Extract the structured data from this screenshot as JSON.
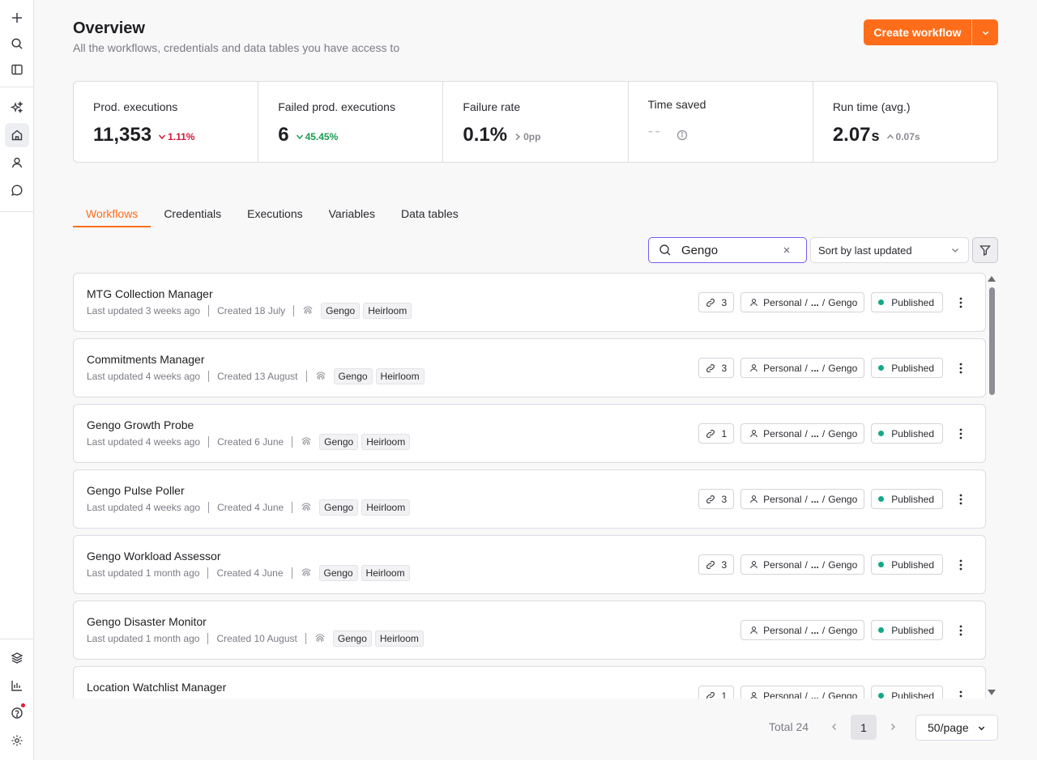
{
  "sidebar": {
    "top": [
      {
        "name": "plus-icon"
      },
      {
        "name": "search-icon"
      },
      {
        "name": "panel-toggle-icon"
      }
    ],
    "nav": [
      {
        "name": "sparkles-icon"
      },
      {
        "name": "home-icon",
        "active": true
      },
      {
        "name": "user-icon"
      },
      {
        "name": "chat-icon"
      }
    ],
    "bottom": [
      {
        "name": "templates-icon"
      },
      {
        "name": "insights-chart-icon"
      },
      {
        "name": "help-icon",
        "notification": true
      },
      {
        "name": "settings-gear-icon"
      }
    ]
  },
  "header": {
    "title": "Overview",
    "subtitle": "All the workflows, credentials and data tables you have access to",
    "create_button": "Create workflow"
  },
  "stats": [
    {
      "label": "Prod. executions",
      "value": "11,353",
      "unit": "",
      "delta": "1.11%",
      "delta_dir": "down",
      "delta_color": "red"
    },
    {
      "label": "Failed prod. executions",
      "value": "6",
      "unit": "",
      "delta": "45.45%",
      "delta_dir": "down",
      "delta_color": "green"
    },
    {
      "label": "Failure rate",
      "value": "0.1%",
      "unit": "",
      "delta": "0pp",
      "delta_dir": "right",
      "delta_color": "gray"
    },
    {
      "label": "Time saved",
      "value": "--",
      "unit": "",
      "delta": "",
      "delta_dir": "none",
      "delta_color": "gray"
    },
    {
      "label": "Run time (avg.)",
      "value": "2.07",
      "unit": "s",
      "delta": "0.07s",
      "delta_dir": "up",
      "delta_color": "gray"
    }
  ],
  "tabs": [
    "Workflows",
    "Credentials",
    "Executions",
    "Variables",
    "Data tables"
  ],
  "active_tab": "Workflows",
  "search": {
    "value": "Gengo",
    "placeholder": "Search"
  },
  "sort": {
    "selected": "Sort by last updated"
  },
  "workflows": [
    {
      "title": "MTG Collection Manager",
      "updated": "Last updated 3 weeks ago",
      "created": "Created 18 July",
      "tags": [
        "Gengo",
        "Heirloom"
      ],
      "links": "3",
      "project": "Personal",
      "ellipsis": "...",
      "folder": "Gengo",
      "status": "Published"
    },
    {
      "title": "Commitments Manager",
      "updated": "Last updated 4 weeks ago",
      "created": "Created 13 August",
      "tags": [
        "Gengo",
        "Heirloom"
      ],
      "links": "3",
      "project": "Personal",
      "ellipsis": "...",
      "folder": "Gengo",
      "status": "Published"
    },
    {
      "title": "Gengo Growth Probe",
      "updated": "Last updated 4 weeks ago",
      "created": "Created 6 June",
      "tags": [
        "Gengo",
        "Heirloom"
      ],
      "links": "1",
      "project": "Personal",
      "ellipsis": "...",
      "folder": "Gengo",
      "status": "Published"
    },
    {
      "title": "Gengo Pulse Poller",
      "updated": "Last updated 4 weeks ago",
      "created": "Created 4 June",
      "tags": [
        "Gengo",
        "Heirloom"
      ],
      "links": "3",
      "project": "Personal",
      "ellipsis": "...",
      "folder": "Gengo",
      "status": "Published"
    },
    {
      "title": "Gengo Workload Assessor",
      "updated": "Last updated 1 month ago",
      "created": "Created 4 June",
      "tags": [
        "Gengo",
        "Heirloom"
      ],
      "links": "3",
      "project": "Personal",
      "ellipsis": "...",
      "folder": "Gengo",
      "status": "Published"
    },
    {
      "title": "Gengo Disaster Monitor",
      "updated": "Last updated 1 month ago",
      "created": "Created 10 August",
      "tags": [
        "Gengo",
        "Heirloom"
      ],
      "links": null,
      "project": "Personal",
      "ellipsis": "...",
      "folder": "Gengo",
      "status": "Published"
    },
    {
      "title": "Location Watchlist Manager",
      "updated": "",
      "created": "",
      "tags": [],
      "links": "1",
      "project": "Personal",
      "ellipsis": "...",
      "folder": "Gengo",
      "status": "Published"
    }
  ],
  "pagination": {
    "total": "Total 24",
    "current_page": "1",
    "per_page": "50/page"
  },
  "colors": {
    "accent": "#ff6d1a",
    "published_dot": "#13a889",
    "search_focus": "#7a5cf0",
    "delta_red": "#d5173a",
    "delta_green": "#1a9b52"
  }
}
